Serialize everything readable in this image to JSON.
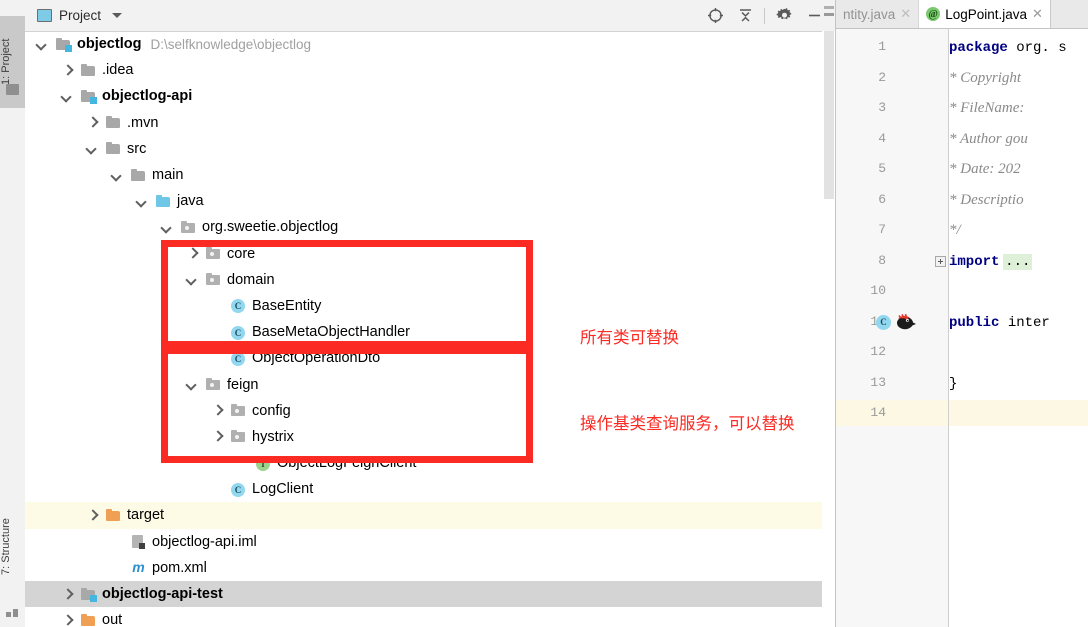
{
  "stripe": {
    "project_button": "1: Project",
    "structure_button": "7: Structure",
    "project_icon": "folder-icon",
    "structure_icon": "structure-icon"
  },
  "pane": {
    "title": "Project",
    "title_icon": "project-window-icon",
    "dropdown_icon": "chevron-down-icon",
    "tools": [
      {
        "name": "locate-icon",
        "label": "Select Opened File"
      },
      {
        "name": "collapse-all-icon",
        "label": "Collapse All"
      },
      {
        "name": "gear-icon",
        "label": "Settings"
      },
      {
        "name": "minimize-icon",
        "label": "Hide"
      }
    ]
  },
  "tree": {
    "rows": [
      {
        "indent": 0,
        "arrow": "down",
        "icon": "module-icon",
        "label": "objectlog",
        "bold": true,
        "path": "D:\\selfknowledge\\objectlog"
      },
      {
        "indent": 1,
        "arrow": "right",
        "icon": "folder-icon",
        "label": ".idea",
        "bold": false,
        "path": ""
      },
      {
        "indent": 1,
        "arrow": "down",
        "icon": "module-icon",
        "label": "objectlog-api",
        "bold": true,
        "path": ""
      },
      {
        "indent": 2,
        "arrow": "right",
        "icon": "folder-icon",
        "label": ".mvn",
        "bold": false,
        "path": ""
      },
      {
        "indent": 2,
        "arrow": "down",
        "icon": "folder-icon",
        "label": "src",
        "bold": false,
        "path": ""
      },
      {
        "indent": 3,
        "arrow": "down",
        "icon": "folder-icon",
        "label": "main",
        "bold": false,
        "path": ""
      },
      {
        "indent": 4,
        "arrow": "down",
        "icon": "source-folder-icon",
        "label": "java",
        "bold": false,
        "path": ""
      },
      {
        "indent": 5,
        "arrow": "down",
        "icon": "package-icon",
        "label": "org.sweetie.objectlog",
        "bold": false,
        "path": ""
      },
      {
        "indent": 6,
        "arrow": "right",
        "icon": "package-icon",
        "label": "core",
        "bold": false,
        "path": ""
      },
      {
        "indent": 6,
        "arrow": "down",
        "icon": "package-icon",
        "label": "domain",
        "bold": false,
        "path": ""
      },
      {
        "indent": 7,
        "arrow": "none",
        "icon": "class-icon",
        "label": "BaseEntity",
        "bold": false,
        "path": ""
      },
      {
        "indent": 7,
        "arrow": "none",
        "icon": "class-icon",
        "label": "BaseMetaObjectHandler",
        "bold": false,
        "path": ""
      },
      {
        "indent": 7,
        "arrow": "none",
        "icon": "class-icon",
        "label": "ObjectOperationDto",
        "bold": false,
        "path": ""
      },
      {
        "indent": 6,
        "arrow": "down",
        "icon": "package-icon",
        "label": "feign",
        "bold": false,
        "path": ""
      },
      {
        "indent": 7,
        "arrow": "right",
        "icon": "package-icon",
        "label": "config",
        "bold": false,
        "path": ""
      },
      {
        "indent": 7,
        "arrow": "right",
        "icon": "package-icon",
        "label": "hystrix",
        "bold": false,
        "path": ""
      },
      {
        "indent": 8,
        "arrow": "none",
        "icon": "interface-icon",
        "label": "ObjectLogFeignClient",
        "bold": false,
        "path": ""
      },
      {
        "indent": 7,
        "arrow": "none",
        "icon": "class-icon",
        "label": "LogClient",
        "bold": false,
        "path": ""
      },
      {
        "indent": 2,
        "arrow": "right",
        "icon": "excluded-folder-icon",
        "label": "target",
        "bold": false,
        "path": "",
        "excluded": true
      },
      {
        "indent": 3,
        "arrow": "none",
        "icon": "iml-file-icon",
        "label": "objectlog-api.iml",
        "bold": false,
        "path": ""
      },
      {
        "indent": 3,
        "arrow": "none",
        "icon": "maven-file-icon",
        "label": "pom.xml",
        "bold": false,
        "path": ""
      },
      {
        "indent": 1,
        "arrow": "right",
        "icon": "module-icon",
        "label": "objectlog-api-test",
        "bold": true,
        "path": "",
        "selected": true
      },
      {
        "indent": 1,
        "arrow": "right",
        "icon": "excluded-folder-icon",
        "label": "out",
        "bold": false,
        "path": ""
      }
    ]
  },
  "annotations": {
    "box_color": "#fb2a23",
    "items": [
      {
        "text": "所有类可替换"
      },
      {
        "text": "操作基类查询服务，可以替换"
      }
    ]
  },
  "editor": {
    "tabs": [
      {
        "label": "ntity.java",
        "icon": "none",
        "active": false,
        "close_icon": "close-icon"
      },
      {
        "label": "LogPoint.java",
        "icon": "annotation-icon",
        "icon_char": "@",
        "active": true,
        "close_icon": "close-icon"
      }
    ],
    "line_numbers": [
      "1",
      "2",
      "3",
      "4",
      "5",
      "6",
      "7",
      "8",
      "10",
      "11",
      "12",
      "13",
      "14"
    ],
    "lines": [
      {
        "no": "1",
        "kind": "code",
        "text": "package org. s"
      },
      {
        "no": "2",
        "kind": "comment",
        "text": "* Copyright "
      },
      {
        "no": "3",
        "kind": "comment",
        "text": "* FileName: "
      },
      {
        "no": "4",
        "kind": "comment",
        "text": "* Author gou"
      },
      {
        "no": "5",
        "kind": "comment",
        "text": "* Date: 202"
      },
      {
        "no": "6",
        "kind": "comment",
        "text": "* Descriptio"
      },
      {
        "no": "7",
        "kind": "comment",
        "text": "*/"
      },
      {
        "no": "8",
        "kind": "import",
        "text": "import",
        "ellipsis": "..."
      },
      {
        "no": "10",
        "kind": "blank",
        "text": ""
      },
      {
        "no": "11",
        "kind": "code",
        "text": "public inter"
      },
      {
        "no": "12",
        "kind": "blank",
        "text": ""
      },
      {
        "no": "13",
        "kind": "code",
        "text": "}"
      },
      {
        "no": "14",
        "kind": "current",
        "text": ""
      }
    ],
    "gutter_icons": [
      {
        "name": "class-gutter-icon",
        "char": "C"
      },
      {
        "name": "lombok-icon",
        "char": ""
      }
    ],
    "keywords": {
      "package": "package",
      "import": "import",
      "public": "public",
      "interface_part": "inter"
    }
  }
}
